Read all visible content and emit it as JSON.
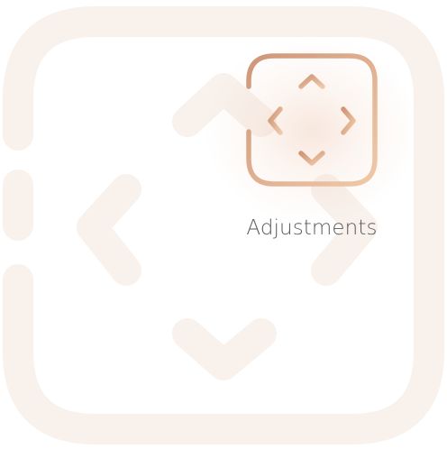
{
  "colors": {
    "watermark": "#f8f1ec",
    "icon_gradient_start": "#cf9678",
    "icon_gradient_end": "#f0c9a8",
    "label": "#5a5a5a",
    "glow": "#f1d6c6"
  },
  "icons": {
    "background": "adjustments-icon",
    "primary": "adjustments-icon"
  },
  "tile": {
    "label": "Adjustments"
  }
}
